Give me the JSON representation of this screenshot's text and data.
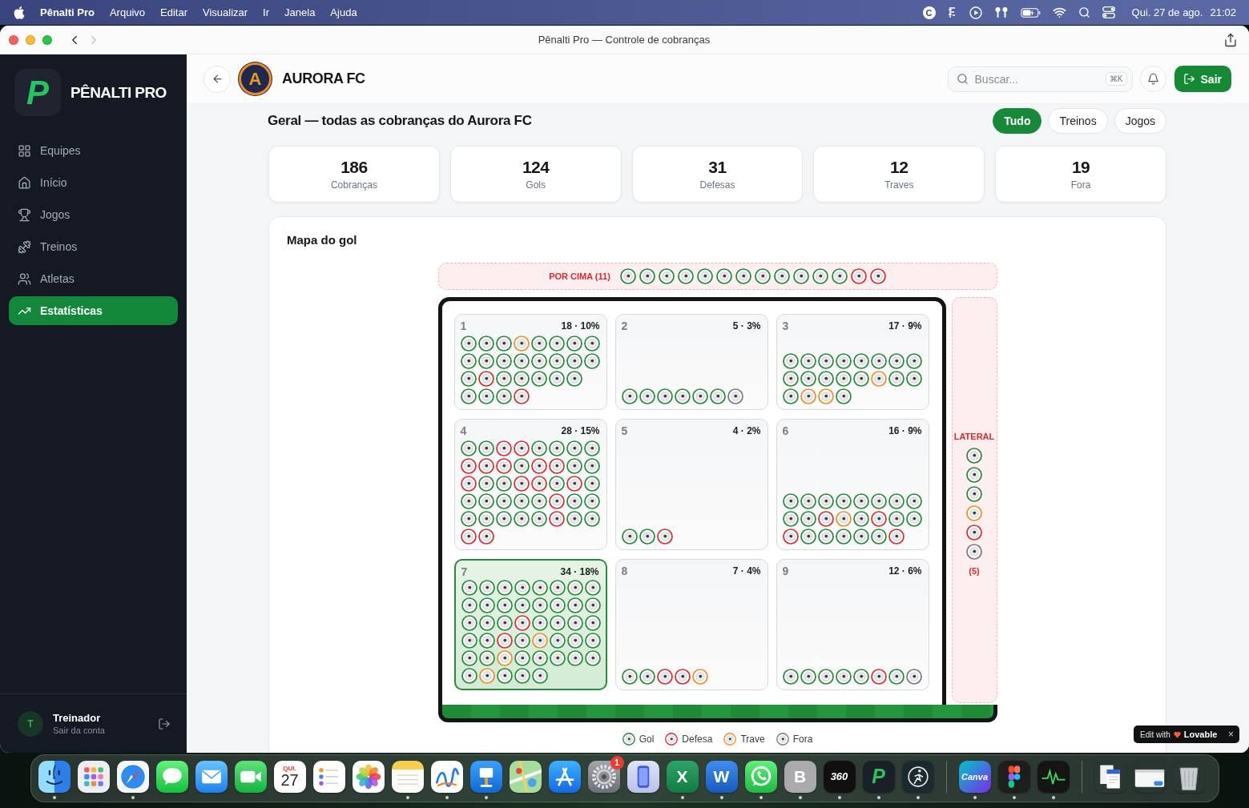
{
  "menu_bar": {
    "app_name": "Pênalti Pro",
    "menus": [
      "Arquivo",
      "Editar",
      "Visualizar",
      "Ir",
      "Janela",
      "Ajuda"
    ],
    "status_icons": [
      {
        "kind": "letter-circle",
        "text": "C"
      },
      {
        "kind": "glyph"
      },
      {
        "kind": "play"
      },
      {
        "kind": "earbuds"
      },
      {
        "kind": "battery"
      },
      {
        "kind": "wifi"
      },
      {
        "kind": "search"
      },
      {
        "kind": "toggles"
      }
    ],
    "date": "Qui. 27 de ago.",
    "time": "21:02"
  },
  "window": {
    "title": "Pênalti Pro — Controle de cobranças",
    "nav": [
      {
        "kind": "back",
        "disabled": false
      },
      {
        "kind": "forward",
        "disabled": true
      }
    ]
  },
  "sidebar": {
    "brand_mark": "P",
    "brand": "PÊNALTI PRO",
    "items": [
      {
        "kind": "teams",
        "label": "Equipes",
        "selected": false
      },
      {
        "kind": "home",
        "label": "Início",
        "selected": false
      },
      {
        "kind": "games",
        "label": "Jogos",
        "selected": false
      },
      {
        "kind": "training",
        "label": "Treinos",
        "selected": false
      },
      {
        "kind": "athletes",
        "label": "Atletas",
        "selected": false
      },
      {
        "kind": "stats",
        "label": "Estatísticas",
        "selected": true
      }
    ],
    "user": {
      "initial": "T",
      "name": "Treinador",
      "subtitle": "Sair da conta"
    }
  },
  "header": {
    "team": {
      "crest_letter": "A",
      "name": "AURORA FC"
    },
    "search": {
      "placeholder": "Buscar...",
      "shortcut": "⌘K"
    },
    "logout": "Sair"
  },
  "page": {
    "heading": "Geral — todas as cobranças do Aurora FC",
    "filters": [
      {
        "label": "Tudo",
        "selected": true
      },
      {
        "label": "Treinos",
        "selected": false
      },
      {
        "label": "Jogos",
        "selected": false
      }
    ]
  },
  "stats": [
    {
      "value": "186",
      "label": "Cobranças"
    },
    {
      "value": "124",
      "label": "Gols"
    },
    {
      "value": "31",
      "label": "Defesas"
    },
    {
      "value": "12",
      "label": "Traves"
    },
    {
      "value": "19",
      "label": "Fora"
    }
  ],
  "goal_map": {
    "title": "Mapa do gol",
    "over": {
      "label": "POR CIMA (11)",
      "shots": [
        {
          "kind": "gol"
        },
        {
          "kind": "gol"
        },
        {
          "kind": "gol"
        },
        {
          "kind": "gol"
        },
        {
          "kind": "gol"
        },
        {
          "kind": "gol"
        },
        {
          "kind": "gol"
        },
        {
          "kind": "gol"
        },
        {
          "kind": "gol"
        },
        {
          "kind": "gol"
        },
        {
          "kind": "gol"
        },
        {
          "kind": "gol"
        },
        {
          "kind": "defesa"
        },
        {
          "kind": "defesa"
        }
      ]
    },
    "zones": [
      {
        "number": "1",
        "summary": "18 · 10%",
        "highlighted": false,
        "shot_rows": [
          [
            {
              "kind": "gol"
            },
            {
              "kind": "gol"
            },
            {
              "kind": "gol"
            },
            {
              "kind": "trave"
            },
            {
              "kind": "gol"
            },
            {
              "kind": "gol"
            },
            {
              "kind": "gol"
            },
            {
              "kind": "gol"
            }
          ],
          [
            {
              "kind": "gol"
            },
            {
              "kind": "gol"
            },
            {
              "kind": "gol"
            },
            {
              "kind": "gol"
            },
            {
              "kind": "gol"
            },
            {
              "kind": "gol"
            },
            {
              "kind": "gol"
            },
            {
              "kind": "gol"
            }
          ],
          [
            {
              "kind": "gol"
            },
            {
              "kind": "defesa"
            },
            {
              "kind": "gol"
            },
            {
              "kind": "gol"
            },
            {
              "kind": "gol"
            },
            {
              "kind": "gol"
            },
            {
              "kind": "gol"
            }
          ],
          [
            {
              "kind": "gol"
            },
            {
              "kind": "gol"
            },
            {
              "kind": "gol"
            },
            {
              "kind": "defesa"
            }
          ]
        ]
      },
      {
        "number": "2",
        "summary": "5 · 3%",
        "highlighted": false,
        "shot_rows": [
          [
            {
              "kind": "gol"
            },
            {
              "kind": "gol"
            },
            {
              "kind": "gol"
            },
            {
              "kind": "gol"
            },
            {
              "kind": "gol"
            },
            {
              "kind": "gol"
            },
            {
              "kind": "fora"
            }
          ]
        ]
      },
      {
        "number": "3",
        "summary": "17 · 9%",
        "highlighted": false,
        "shot_rows": [
          [
            {
              "kind": "gol"
            },
            {
              "kind": "gol"
            },
            {
              "kind": "gol"
            },
            {
              "kind": "gol"
            },
            {
              "kind": "gol"
            },
            {
              "kind": "gol"
            },
            {
              "kind": "gol"
            },
            {
              "kind": "gol"
            }
          ],
          [
            {
              "kind": "gol"
            },
            {
              "kind": "gol"
            },
            {
              "kind": "gol"
            },
            {
              "kind": "gol"
            },
            {
              "kind": "gol"
            },
            {
              "kind": "trave"
            },
            {
              "kind": "gol"
            },
            {
              "kind": "gol"
            }
          ],
          [
            {
              "kind": "gol"
            },
            {
              "kind": "trave"
            },
            {
              "kind": "trave"
            },
            {
              "kind": "gol"
            }
          ]
        ]
      },
      {
        "number": "4",
        "summary": "28 · 15%",
        "highlighted": false,
        "shot_rows": [
          [
            {
              "kind": "gol"
            },
            {
              "kind": "gol"
            },
            {
              "kind": "defesa"
            },
            {
              "kind": "defesa"
            },
            {
              "kind": "gol"
            },
            {
              "kind": "gol"
            },
            {
              "kind": "gol"
            },
            {
              "kind": "gol"
            }
          ],
          [
            {
              "kind": "defesa"
            },
            {
              "kind": "defesa"
            },
            {
              "kind": "defesa"
            },
            {
              "kind": "gol"
            },
            {
              "kind": "defesa"
            },
            {
              "kind": "defesa"
            },
            {
              "kind": "gol"
            },
            {
              "kind": "gol"
            }
          ],
          [
            {
              "kind": "defesa"
            },
            {
              "kind": "gol"
            },
            {
              "kind": "gol"
            },
            {
              "kind": "defesa"
            },
            {
              "kind": "defesa"
            },
            {
              "kind": "gol"
            },
            {
              "kind": "defesa"
            },
            {
              "kind": "gol"
            }
          ],
          [
            {
              "kind": "gol"
            },
            {
              "kind": "gol"
            },
            {
              "kind": "gol"
            },
            {
              "kind": "gol"
            },
            {
              "kind": "gol"
            },
            {
              "kind": "defesa"
            },
            {
              "kind": "gol"
            },
            {
              "kind": "gol"
            }
          ],
          [
            {
              "kind": "gol"
            },
            {
              "kind": "gol"
            },
            {
              "kind": "gol"
            },
            {
              "kind": "gol"
            },
            {
              "kind": "gol"
            },
            {
              "kind": "defesa"
            },
            {
              "kind": "gol"
            },
            {
              "kind": "gol"
            }
          ],
          [
            {
              "kind": "defesa"
            },
            {
              "kind": "defesa"
            }
          ]
        ]
      },
      {
        "number": "5",
        "summary": "4 · 2%",
        "highlighted": false,
        "shot_rows": [
          [
            {
              "kind": "gol"
            },
            {
              "kind": "gol"
            },
            {
              "kind": "defesa"
            }
          ]
        ]
      },
      {
        "number": "6",
        "summary": "16 · 9%",
        "highlighted": false,
        "shot_rows": [
          [
            {
              "kind": "gol"
            },
            {
              "kind": "gol"
            },
            {
              "kind": "gol"
            },
            {
              "kind": "gol"
            },
            {
              "kind": "gol"
            },
            {
              "kind": "gol"
            },
            {
              "kind": "gol"
            },
            {
              "kind": "gol"
            }
          ],
          [
            {
              "kind": "gol"
            },
            {
              "kind": "gol"
            },
            {
              "kind": "defesa"
            },
            {
              "kind": "trave"
            },
            {
              "kind": "gol"
            },
            {
              "kind": "defesa"
            },
            {
              "kind": "gol"
            },
            {
              "kind": "gol"
            }
          ],
          [
            {
              "kind": "defesa"
            },
            {
              "kind": "gol"
            },
            {
              "kind": "gol"
            },
            {
              "kind": "gol"
            },
            {
              "kind": "gol"
            },
            {
              "kind": "gol"
            },
            {
              "kind": "defesa"
            }
          ]
        ]
      },
      {
        "number": "7",
        "summary": "34 · 18%",
        "highlighted": true,
        "shot_rows": [
          [
            {
              "kind": "gol"
            },
            {
              "kind": "gol"
            },
            {
              "kind": "gol"
            },
            {
              "kind": "gol"
            },
            {
              "kind": "gol"
            },
            {
              "kind": "gol"
            },
            {
              "kind": "gol"
            },
            {
              "kind": "gol"
            }
          ],
          [
            {
              "kind": "gol"
            },
            {
              "kind": "gol"
            },
            {
              "kind": "gol"
            },
            {
              "kind": "gol"
            },
            {
              "kind": "gol"
            },
            {
              "kind": "gol"
            },
            {
              "kind": "gol"
            },
            {
              "kind": "gol"
            }
          ],
          [
            {
              "kind": "gol"
            },
            {
              "kind": "gol"
            },
            {
              "kind": "gol"
            },
            {
              "kind": "defesa"
            },
            {
              "kind": "gol"
            },
            {
              "kind": "gol"
            },
            {
              "kind": "gol"
            },
            {
              "kind": "gol"
            }
          ],
          [
            {
              "kind": "gol"
            },
            {
              "kind": "gol"
            },
            {
              "kind": "defesa"
            },
            {
              "kind": "gol"
            },
            {
              "kind": "trave"
            },
            {
              "kind": "gol"
            },
            {
              "kind": "gol"
            },
            {
              "kind": "gol"
            }
          ],
          [
            {
              "kind": "gol"
            },
            {
              "kind": "gol"
            },
            {
              "kind": "trave"
            },
            {
              "kind": "gol"
            },
            {
              "kind": "gol"
            },
            {
              "kind": "gol"
            },
            {
              "kind": "gol"
            },
            {
              "kind": "gol"
            }
          ],
          [
            {
              "kind": "gol"
            },
            {
              "kind": "trave"
            },
            {
              "kind": "gol"
            },
            {
              "kind": "gol"
            },
            {
              "kind": "gol"
            }
          ]
        ]
      },
      {
        "number": "8",
        "summary": "7 · 4%",
        "highlighted": false,
        "shot_rows": [
          [
            {
              "kind": "gol"
            },
            {
              "kind": "gol"
            },
            {
              "kind": "defesa"
            },
            {
              "kind": "defesa"
            },
            {
              "kind": "trave"
            }
          ]
        ]
      },
      {
        "number": "9",
        "summary": "12 · 6%",
        "highlighted": false,
        "shot_rows": [
          [
            {
              "kind": "gol"
            },
            {
              "kind": "gol"
            },
            {
              "kind": "gol"
            },
            {
              "kind": "gol"
            },
            {
              "kind": "gol"
            },
            {
              "kind": "defesa"
            },
            {
              "kind": "gol"
            },
            {
              "kind": "fora"
            }
          ]
        ]
      }
    ],
    "lateral": {
      "label": "LATERAL",
      "shots": [
        {
          "kind": "gol"
        },
        {
          "kind": "gol"
        },
        {
          "kind": "gol"
        },
        {
          "kind": "trave"
        },
        {
          "kind": "defesa"
        },
        {
          "kind": "fora"
        }
      ],
      "count": "(5)"
    },
    "legend": [
      {
        "kind": "gol",
        "label": "Gol"
      },
      {
        "kind": "defesa",
        "label": "Defesa"
      },
      {
        "kind": "trave",
        "label": "Trave"
      },
      {
        "kind": "fora",
        "label": "Fora"
      }
    ]
  },
  "promo_badge": {
    "prefix": "Edit with",
    "brand": "Lovable",
    "close": "×"
  },
  "dock": {
    "items": [
      {
        "kind": "face",
        "running": true
      },
      {
        "kind": "grid",
        "running": false
      },
      {
        "kind": "compass",
        "running": true
      },
      {
        "kind": "chat",
        "running": false
      },
      {
        "kind": "mail",
        "running": false
      },
      {
        "kind": "video",
        "running": false
      },
      {
        "kind": "calendar",
        "weekday": "QUI.",
        "date": "27",
        "running": false
      },
      {
        "kind": "checklist",
        "running": false
      },
      {
        "kind": "flower",
        "running": false
      },
      {
        "kind": "notepad",
        "running": true
      },
      {
        "kind": "scribble",
        "running": true
      },
      {
        "kind": "lectern",
        "running": true
      },
      {
        "kind": "map",
        "running": false
      },
      {
        "kind": "tools",
        "running": false
      },
      {
        "kind": "gear",
        "badge": "1",
        "running": false
      },
      {
        "kind": "phone",
        "running": false
      },
      {
        "kind": "sheet",
        "text": "X",
        "running": true
      },
      {
        "kind": "doc",
        "text": "W",
        "running": true
      },
      {
        "kind": "phone-bubble",
        "running": true
      },
      {
        "kind": "letter",
        "text": "B",
        "running": true
      },
      {
        "kind": "text-dark",
        "text": "360",
        "running": true
      },
      {
        "kind": "pmark",
        "text": "P",
        "running": true
      },
      {
        "kind": "runner",
        "running": true
      },
      {
        "kind": "separator"
      },
      {
        "kind": "canva",
        "text": "Canva",
        "running": true
      },
      {
        "kind": "shapes",
        "running": true
      },
      {
        "kind": "pulse",
        "running": true
      },
      {
        "kind": "separator"
      },
      {
        "kind": "stack",
        "running": false
      },
      {
        "kind": "preview",
        "running": false
      },
      {
        "kind": "trash",
        "running": false
      }
    ]
  }
}
